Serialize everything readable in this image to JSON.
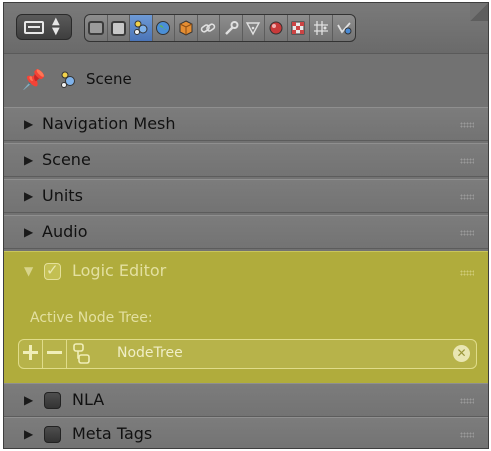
{
  "toolbar": {
    "context_tabs": [
      {
        "icon": "render-icon",
        "active": false
      },
      {
        "icon": "render-layers-icon",
        "active": false
      },
      {
        "icon": "scene-icon",
        "active": true
      },
      {
        "icon": "world-icon",
        "active": false
      },
      {
        "icon": "object-icon",
        "active": false
      },
      {
        "icon": "constraints-icon",
        "active": false
      },
      {
        "icon": "modifiers-icon",
        "active": false
      },
      {
        "icon": "data-icon",
        "active": false
      },
      {
        "icon": "material-icon",
        "active": false
      },
      {
        "icon": "texture-icon",
        "active": false
      },
      {
        "icon": "particles-icon",
        "active": false
      },
      {
        "icon": "physics-icon",
        "active": false
      }
    ]
  },
  "context": {
    "label": "Scene"
  },
  "panels": {
    "navigation_mesh": {
      "label": "Navigation Mesh"
    },
    "scene": {
      "label": "Scene"
    },
    "units": {
      "label": "Units"
    },
    "audio": {
      "label": "Audio"
    },
    "logic_editor": {
      "label": "Logic Editor",
      "enabled": true,
      "field_label": "Active Node Tree:",
      "node_tree": "NodeTree"
    },
    "nla": {
      "label": "NLA",
      "enabled": false
    },
    "meta_tags": {
      "label": "Meta Tags",
      "enabled": false
    }
  },
  "colors": {
    "highlight": "#b0ac3c",
    "panel": "#767676",
    "active_tab": "#5a83c6"
  }
}
